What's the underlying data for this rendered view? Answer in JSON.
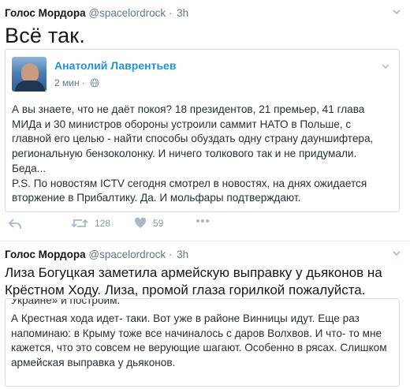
{
  "tweet1": {
    "author_name": "Голос Мордора",
    "handle": "@spacelordrock",
    "dot": "·",
    "time": "3h",
    "text": "Всё так.",
    "quoted": {
      "author_name": "Анатолий Лаврентьев",
      "time": "2 мин",
      "paragraph1": "А вы знаете, что не даёт покоя? 18 президентов, 21 премьер, 41 глава МИДа и 30 министров обороны устроили саммит НАТО в Польше, с главной его целью - найти способы обуздать одну страну дауншифтера, региональную бензоколонку. И ничего толкового так и не придумали. Беда...",
      "paragraph2": "P.S. По новостям ICTV сегодня смотрел в новостях, на днях ожидается вторжение в Прибалтику. Да. И мольфары подтверждают."
    },
    "actions": {
      "retweet_count": "128",
      "like_count": "59"
    }
  },
  "tweet2": {
    "author_name": "Голос Мордора",
    "handle": "@spacelordrock",
    "dot": "·",
    "time": "3h",
    "text": "Лиза Богуцкая заметила армейскую выправку у дьяконов на Крёстном Ходу. Лиза, промой глаза горилкой пожалуйста.",
    "quoted": {
      "cut_line": "Украине» и построим.",
      "text": "А Крестная хода идет- таки. Вот уже в районе Винницы идут. Еще раз напоминаю: в Крыму тоже все начиналось с даров Волхвов. И что- то мне кажется, что это совсем не верующие шагают. Особенно в рясах. Слишком армейская выправка у дьяконов."
    }
  },
  "colors": {
    "link_blue": "#1b95e0",
    "meta_gray": "#657786",
    "icon_gray": "#aab8c2",
    "border": "#e6ecf0"
  }
}
